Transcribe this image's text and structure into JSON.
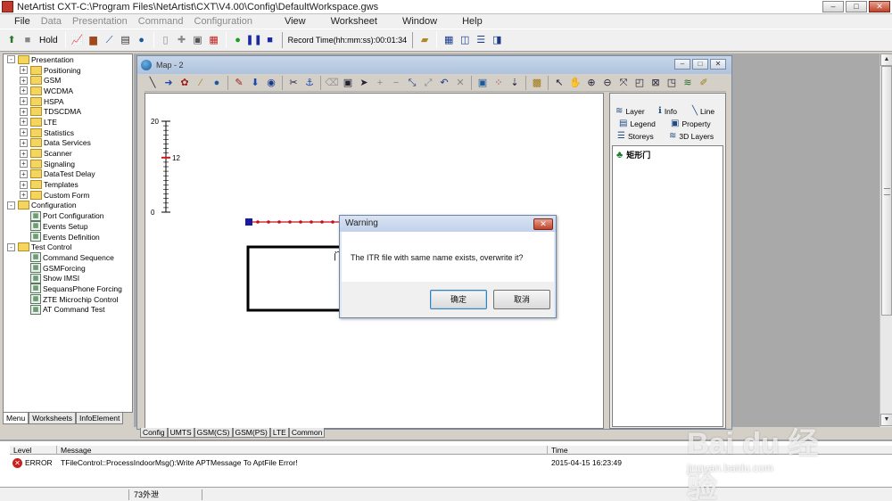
{
  "window": {
    "title": "NetArtist CXT-C:\\Program Files\\NetArtist\\CXT\\V4.00\\Config\\DefaultWorkspace.gws",
    "buttons": [
      "–",
      "□",
      "✕"
    ]
  },
  "menubar": {
    "items": [
      {
        "label": "File",
        "enabled": true
      },
      {
        "label": "Data",
        "enabled": false
      },
      {
        "label": "Presentation",
        "enabled": false
      },
      {
        "label": "Command",
        "enabled": false
      },
      {
        "label": "Configuration",
        "enabled": false
      },
      {
        "label": "View",
        "enabled": true
      },
      {
        "label": "Worksheet",
        "enabled": true
      },
      {
        "label": "Window",
        "enabled": true
      },
      {
        "label": "Help",
        "enabled": true
      }
    ]
  },
  "toolbar": {
    "hold_label": "Hold",
    "record_time": "Record Time(hh:mm:ss):00:01:34"
  },
  "tree": {
    "rows": [
      {
        "label": "Presentation",
        "level": 0,
        "kind": "folder",
        "exp": "-"
      },
      {
        "label": "Positioning",
        "level": 1,
        "kind": "folder",
        "exp": "+"
      },
      {
        "label": "GSM",
        "level": 1,
        "kind": "folder",
        "exp": "+"
      },
      {
        "label": "WCDMA",
        "level": 1,
        "kind": "folder",
        "exp": "+"
      },
      {
        "label": "HSPA",
        "level": 1,
        "kind": "folder",
        "exp": "+"
      },
      {
        "label": "TDSCDMA",
        "level": 1,
        "kind": "folder",
        "exp": "+"
      },
      {
        "label": "LTE",
        "level": 1,
        "kind": "folder",
        "exp": "+"
      },
      {
        "label": "Statistics",
        "level": 1,
        "kind": "folder",
        "exp": "+"
      },
      {
        "label": "Data Services",
        "level": 1,
        "kind": "folder",
        "exp": "+"
      },
      {
        "label": "Scanner",
        "level": 1,
        "kind": "folder",
        "exp": "+"
      },
      {
        "label": "Signaling",
        "level": 1,
        "kind": "folder",
        "exp": "+"
      },
      {
        "label": "DataTest Delay",
        "level": 1,
        "kind": "folder",
        "exp": "+"
      },
      {
        "label": "Templates",
        "level": 1,
        "kind": "folder",
        "exp": "+"
      },
      {
        "label": "Custom Form",
        "level": 1,
        "kind": "folder",
        "exp": "+"
      },
      {
        "label": "Configuration",
        "level": 0,
        "kind": "folder",
        "exp": "-"
      },
      {
        "label": "Port Configuration",
        "level": 1,
        "kind": "doc",
        "exp": ""
      },
      {
        "label": "Events Setup",
        "level": 1,
        "kind": "doc",
        "exp": ""
      },
      {
        "label": "Events Definition",
        "level": 1,
        "kind": "doc",
        "exp": ""
      },
      {
        "label": "Test Control",
        "level": 0,
        "kind": "folder",
        "exp": "-"
      },
      {
        "label": "Command Sequence",
        "level": 1,
        "kind": "doc",
        "exp": ""
      },
      {
        "label": "GSMForcing",
        "level": 1,
        "kind": "doc",
        "exp": ""
      },
      {
        "label": "Show IMSI",
        "level": 1,
        "kind": "doc",
        "exp": ""
      },
      {
        "label": "SequansPhone Forcing",
        "level": 1,
        "kind": "doc",
        "exp": ""
      },
      {
        "label": "ZTE Microchip Control",
        "level": 1,
        "kind": "doc",
        "exp": ""
      },
      {
        "label": "AT Command Test",
        "level": 1,
        "kind": "doc",
        "exp": ""
      }
    ]
  },
  "left_tabs": [
    "Menu",
    "Worksheets",
    "InfoElement"
  ],
  "map_window": {
    "title": "Map - 2",
    "scale": {
      "top_label": "20",
      "mid_label": "12",
      "bottom_label": "0",
      "mid_fraction": 0.6
    },
    "door_label": "门"
  },
  "sidebar": {
    "tabs": [
      {
        "label": "Layer",
        "icon": "layer"
      },
      {
        "label": "Info",
        "icon": "info"
      },
      {
        "label": "Line",
        "icon": "line"
      },
      {
        "label": "Legend",
        "icon": "legend"
      },
      {
        "label": "Property",
        "icon": "property"
      },
      {
        "label": "Storeys",
        "icon": "storeys"
      },
      {
        "label": "3D Layers",
        "icon": "3d-layers"
      }
    ],
    "legend_item": "矩形门"
  },
  "bottom_tabs": [
    "Config",
    "UMTS",
    "GSM(CS)",
    "GSM(PS)",
    "LTE",
    "Common"
  ],
  "log": {
    "headers": {
      "level": "Level",
      "message": "Message",
      "time": "Time"
    },
    "rows": [
      {
        "level": "ERROR",
        "message": "TFileControl::ProcessIndoorMsg():Write APTMessage To AptFile Error!",
        "time": "2015-04-15 16:23:49"
      }
    ]
  },
  "statusbar": {
    "cell": "73外泄"
  },
  "dialog": {
    "title": "Warning",
    "message": "The ITR file with same name exists, overwrite it?",
    "ok_label": "确定",
    "cancel_label": "取消"
  },
  "watermark": {
    "brand": "Bai du 经验",
    "url": "jingyan.baidu.com"
  },
  "colors": {
    "error": "#c8201c",
    "route": "#c0101a",
    "route_start": "#1a1aa0",
    "scale_marker": "#d01818"
  }
}
